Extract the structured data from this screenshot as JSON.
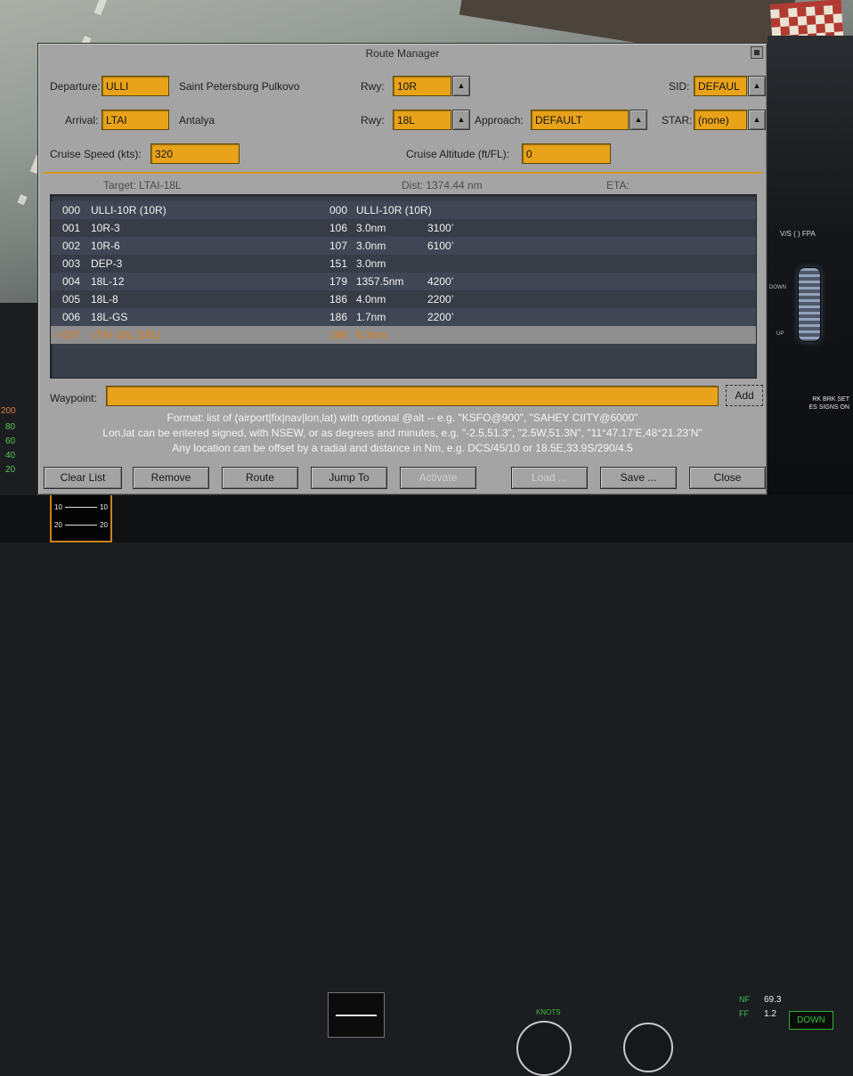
{
  "window": {
    "title": "Route Manager"
  },
  "icons": {
    "up_arrow": "▲"
  },
  "form": {
    "departure_label": "Departure:",
    "departure_value": "ULLI",
    "departure_name": "Saint Petersburg Pulkovo",
    "departure_rwy_label": "Rwy:",
    "departure_rwy": "10R",
    "sid_label": "SID:",
    "sid_value": "DEFAUL",
    "arrival_label": "Arrival:",
    "arrival_value": "LTAI",
    "arrival_name": "Antalya",
    "arrival_rwy_label": "Rwy:",
    "arrival_rwy": "18L",
    "approach_label": "Approach:",
    "approach_value": "DEFAULT",
    "star_label": "STAR:",
    "star_value": "(none)",
    "cruise_speed_label": "Cruise Speed (kts):",
    "cruise_speed_value": "320",
    "cruise_alt_label": "Cruise Altitude (ft/FL):",
    "cruise_alt_value": "0"
  },
  "status": {
    "target": "Target: LTAI-18L",
    "dist": "Dist: 1374.44 nm",
    "eta": "ETA:"
  },
  "route_list": {
    "selected_marker": ">",
    "rows": [
      {
        "idx": "000",
        "name": "ULLI-10R (10R)",
        "brg": "000",
        "dist": "ULLI-10R (10R)",
        "alt": ""
      },
      {
        "idx": "001",
        "name": "10R-3",
        "brg": "106",
        "dist": "3.0nm",
        "alt": "3100’"
      },
      {
        "idx": "002",
        "name": "10R-6",
        "brg": "107",
        "dist": "3.0nm",
        "alt": "6100’"
      },
      {
        "idx": "003",
        "name": "DEP-3",
        "brg": "151",
        "dist": "3.0nm",
        "alt": ""
      },
      {
        "idx": "004",
        "name": "18L-12",
        "brg": "179",
        "dist": "1357.5nm",
        "alt": "4200’"
      },
      {
        "idx": "005",
        "name": "18L-8",
        "brg": "186",
        "dist": "4.0nm",
        "alt": "2200’"
      },
      {
        "idx": "006",
        "name": "18L-GS",
        "brg": "186",
        "dist": "1.7nm",
        "alt": "2200’"
      },
      {
        "idx": "007",
        "name": "LTAI-18L (18L)",
        "brg": "186",
        "dist": "6.3nm",
        "alt": ""
      }
    ]
  },
  "waypoint": {
    "label": "Waypoint:",
    "value": "",
    "add_label": "Add"
  },
  "help": {
    "line1": "Format: list of (airport|fix|nav|lon,lat) with optional @alt -- e.g. \"KSFO@900\", \"SAHEY CIITY@6000\"",
    "line2": "Lon,lat can be entered signed, with NSEW, or as degrees and minutes, e.g. \"-2.5,51.3\", \"2.5W,51.3N\", \"11°47.17’E,48°21.23’N\"",
    "line3": "Any location can be offset by a radial and distance in Nm, e.g. DCS/45/10 or 18.5E,33.9S/290/4.5"
  },
  "buttons": [
    {
      "label": "Clear List",
      "enabled": true
    },
    {
      "label": "Remove",
      "enabled": true
    },
    {
      "label": "Route",
      "enabled": true
    },
    {
      "label": "Jump To",
      "enabled": true
    },
    {
      "label": "Activate",
      "enabled": false
    },
    {
      "label": "Load ...",
      "enabled": false
    },
    {
      "label": "Save ...",
      "enabled": true
    },
    {
      "label": "Close",
      "enabled": true
    }
  ],
  "background": {
    "tape_numbers": [
      "200",
      "80",
      "60",
      "40",
      "20"
    ],
    "right_panel": {
      "vs_fpa": "V/S ( ) FPA",
      "down": "DOWN",
      "up": "UP",
      "placard1": "RK BRK SET",
      "placard2": "ES SIGNS ON"
    },
    "bottom": {
      "knots": "KNOTS",
      "n1_label": "NF",
      "n1_value": "69.3",
      "ff_label": "FF",
      "ff_value": "1.2",
      "gear": "DOWN",
      "trim_numbers": [
        "10",
        "10",
        "20",
        "20"
      ]
    }
  }
}
